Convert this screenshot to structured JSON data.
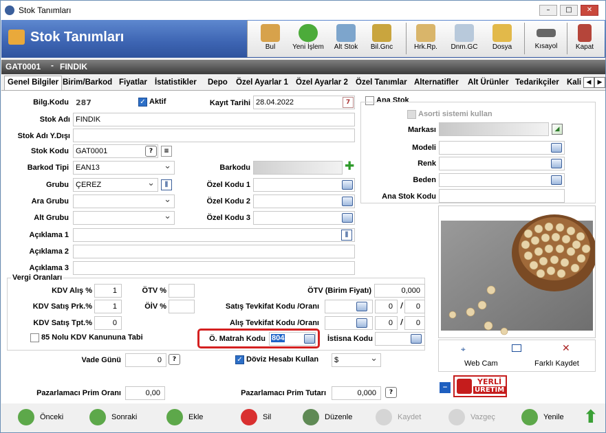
{
  "window": {
    "title": "Stok Tanımları",
    "min": "–",
    "max": "□",
    "close": "✕"
  },
  "header": {
    "title": "Stok Tanımları"
  },
  "toolbar": {
    "bul": "Bul",
    "yeni_islem": "Yeni İşlem",
    "alt_stok": "Alt Stok",
    "bil_gnc": "Bil.Gnc",
    "hrk_rp": "Hrk.Rp.",
    "dnm_gc": "Dnm.GC",
    "dosya": "Dosya",
    "kisayol": "Kısayol",
    "kapat": "Kapat"
  },
  "record": {
    "code": "GAT0001",
    "sep": "-",
    "name": "FINDIK"
  },
  "tabs": [
    "Genel Bilgiler",
    "Birim/Barkod",
    "Fiyatlar",
    "İstatistikler",
    "Depo",
    "Özel Ayarlar 1",
    "Özel Ayarlar 2",
    "Özel Tanımlar",
    "Alternatifler",
    "Alt Ürünler",
    "Tedarikçiler",
    "Kali"
  ],
  "form": {
    "bilg_kodu_label": "Bilg.Kodu",
    "bilg_kodu": "287",
    "aktif": "Aktif",
    "kayit_tarihi_label": "Kayıt Tarihi",
    "kayit_tarihi": "28.04.2022",
    "stok_adi_label": "Stok Adı",
    "stok_adi": "FINDIK",
    "stok_adi_yd_label": "Stok Adı Y.Dışı",
    "stok_adi_yd": "",
    "stok_kodu_label": "Stok Kodu",
    "stok_kodu": "GAT0001",
    "q": "?",
    "barkod_tipi_label": "Barkod Tipi",
    "barkod_tipi": "EAN13",
    "barkodu_label": "Barkodu",
    "grubu_label": "Grubu",
    "grubu": "ÇEREZ",
    "ozel1_label": "Özel Kodu 1",
    "ozel2_label": "Özel Kodu 2",
    "ozel3_label": "Özel Kodu 3",
    "ara_grubu_label": "Ara Grubu",
    "alt_grubu_label": "Alt Grubu",
    "aciklama1_label": "Açıklama 1",
    "aciklama2_label": "Açıklama 2",
    "aciklama3_label": "Açıklama 3",
    "vergi_title": "Vergi Oranları",
    "kdv_alis_label": "KDV Alış %",
    "kdv_alis": "1",
    "kdv_sat_prk_label": "KDV Satış Prk.%",
    "kdv_sat_prk": "1",
    "kdv_sat_tpt_label": "KDV Satış Tpt.%",
    "kdv_sat_tpt": "0",
    "otv_label": "ÖTV %",
    "oiv_label": "ÖİV %",
    "otv_birim_label": "ÖTV (Birim Fiyatı)",
    "otv_birim": "0,000",
    "sat_tevk_label": "Satış Tevkifat Kodu /Oranı",
    "sat_tevk_a": "0",
    "sat_tevk_b": "0",
    "alis_tevk_label": "Alış Tevkifat Kodu /Oranı",
    "alis_tevk_a": "0",
    "alis_tevk_b": "0",
    "slash": "/",
    "kdv85": "85 Nolu KDV Kanununa Tabi",
    "matrah_label": "Ö. Matrah Kodu",
    "matrah": "804",
    "istisna_label": "İstisna Kodu",
    "vade_label": "Vade Günü",
    "vade": "0",
    "doviz_label": "Döviz Hesabı Kullan",
    "doviz": "$",
    "prim_orani_label": "Pazarlamacı Prim Oranı",
    "prim_orani": "0,00",
    "prim_tutari_label": "Pazarlamacı Prim Tutarı",
    "prim_tutari": "0,000"
  },
  "right": {
    "ana_stok": "Ana Stok",
    "asorti": "Asorti sistemi kullan",
    "markasi": "Markası",
    "modeli": "Modeli",
    "renk": "Renk",
    "beden": "Beden",
    "ana_stok_kodu": "Ana Stok Kodu",
    "webcam": "Web Cam",
    "farkli": "Farklı Kaydet",
    "yerli1": "YERLİ",
    "yerli2": "ÜRETİM"
  },
  "bottom": {
    "onceki": "Önceki",
    "sonraki": "Sonraki",
    "ekle": "Ekle",
    "sil": "Sil",
    "duzenle": "Düzenle",
    "kaydet": "Kaydet",
    "vazgec": "Vazgeç",
    "yenile": "Yenile"
  }
}
